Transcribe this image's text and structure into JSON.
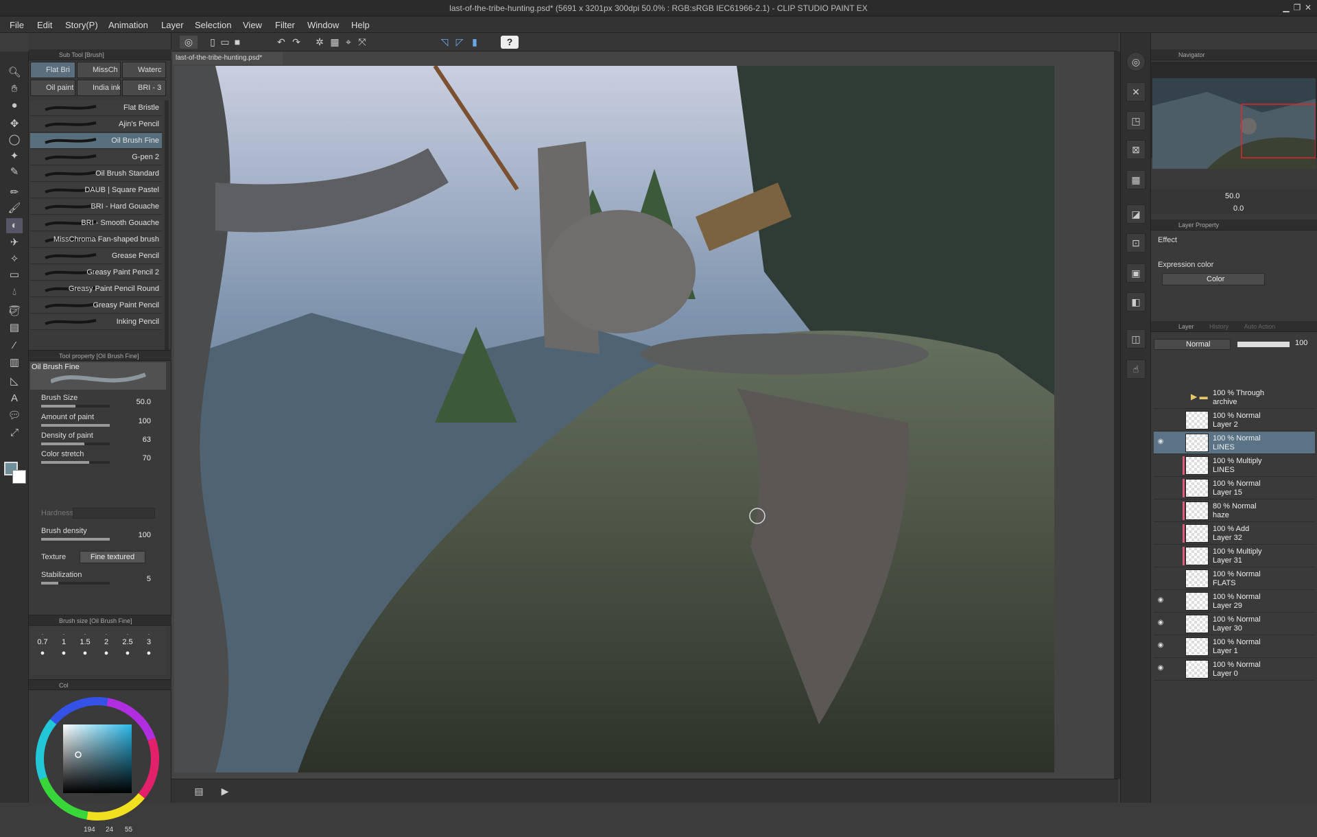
{
  "window": {
    "title": "last-of-the-tribe-hunting.psd* (5691 x 3201px 300dpi 50.0% : RGB:sRGB IEC61966-2.1) - CLIP STUDIO PAINT EX"
  },
  "menu": [
    "File",
    "Edit",
    "Story(P)",
    "Animation",
    "Layer",
    "Selection",
    "View",
    "Filter",
    "Window",
    "Help"
  ],
  "document_tab": "last-of-the-tribe-hunting.psd*",
  "sub_tool": {
    "header": "Sub Tool [Brush]",
    "tabs": [
      "Flat Bri",
      "MissCh",
      "Waterc",
      "Oil paint",
      "India ink",
      "BRI - 3"
    ],
    "brushes": [
      "Flat Bristle",
      "Ajin's Pencil",
      "Oil Brush Fine",
      "G-pen 2",
      "Oil Brush Standard",
      "DAUB | Square Pastel",
      "BRI - Hard Gouache",
      "BRI - Smooth Gouache",
      "MissChroma  Fan-shaped brush",
      "Grease Pencil",
      "Greasy Paint Pencil 2",
      "Greasy Paint Pencil Round",
      "Greasy Paint Pencil",
      "Inking Pencil"
    ],
    "selected": "Oil Brush Fine"
  },
  "tool_property": {
    "header": "Tool property [Oil Brush Fine]",
    "preview_label": "Oil Brush Fine",
    "brush_size": {
      "label": "Brush Size",
      "value": "50.0",
      "level": 0.5
    },
    "amount_of_paint": {
      "label": "Amount of paint",
      "value": "100",
      "level": 1.0
    },
    "density_of_paint": {
      "label": "Density of paint",
      "value": "63",
      "level": 0.63
    },
    "color_stretch": {
      "label": "Color stretch",
      "value": "70",
      "level": 0.7
    },
    "hardness": {
      "label": "Hardness"
    },
    "brush_density": {
      "label": "Brush density",
      "value": "100",
      "level": 1.0
    },
    "texture": {
      "label": "Texture",
      "value": "Fine textured"
    },
    "stabilization": {
      "label": "Stabilization",
      "value": "5",
      "level": 0.25
    }
  },
  "brush_size_panel": {
    "header": "Brush size [Oil Brush Fine]",
    "sizes": [
      "0.7",
      "1",
      "1.5",
      "2",
      "2.5",
      "3"
    ]
  },
  "color_panel": {
    "tab": "Col",
    "hsv": {
      "h": "194",
      "s": "24",
      "v": "55"
    },
    "main_color": "#6e8e9a",
    "sub_color": "#ffffff"
  },
  "navigator": {
    "title": "Navigator",
    "zoom": "50.0",
    "rotation": "0.0"
  },
  "layer_property": {
    "title": "Layer Property",
    "effect_label": "Effect",
    "expression_color_label": "Expression color",
    "expression_color_value": "Color"
  },
  "layer_panel": {
    "tabs": [
      "Layer",
      "History",
      "Auto Action"
    ],
    "blend_mode": "Normal",
    "opacity": "100",
    "layers": [
      {
        "mode": "100 % Through",
        "name": "archive",
        "type": "folder",
        "visible": false
      },
      {
        "mode": "100 % Normal",
        "name": "Layer 2",
        "visible": false
      },
      {
        "mode": "100 % Normal",
        "name": "LINES",
        "visible": true,
        "selected": true
      },
      {
        "mode": "100 % Multiply",
        "name": "LINES",
        "visible": false,
        "clipped": true
      },
      {
        "mode": "100 % Normal",
        "name": "Layer 15",
        "visible": false,
        "clipped": true
      },
      {
        "mode": "80 % Normal",
        "name": "haze",
        "visible": false,
        "clipped": true
      },
      {
        "mode": "100 % Add",
        "name": "Layer 32",
        "visible": false,
        "clipped": true
      },
      {
        "mode": "100 % Multiply",
        "name": "Layer 31",
        "visible": false,
        "clipped": true
      },
      {
        "mode": "100 % Normal",
        "name": "FLATS",
        "visible": false
      },
      {
        "mode": "100 % Normal",
        "name": "Layer 29",
        "visible": true
      },
      {
        "mode": "100 % Normal",
        "name": "Layer 30",
        "visible": true
      },
      {
        "mode": "100 % Normal",
        "name": "Layer 1",
        "visible": true
      },
      {
        "mode": "100 % Normal",
        "name": "Layer 0",
        "visible": true
      }
    ]
  }
}
